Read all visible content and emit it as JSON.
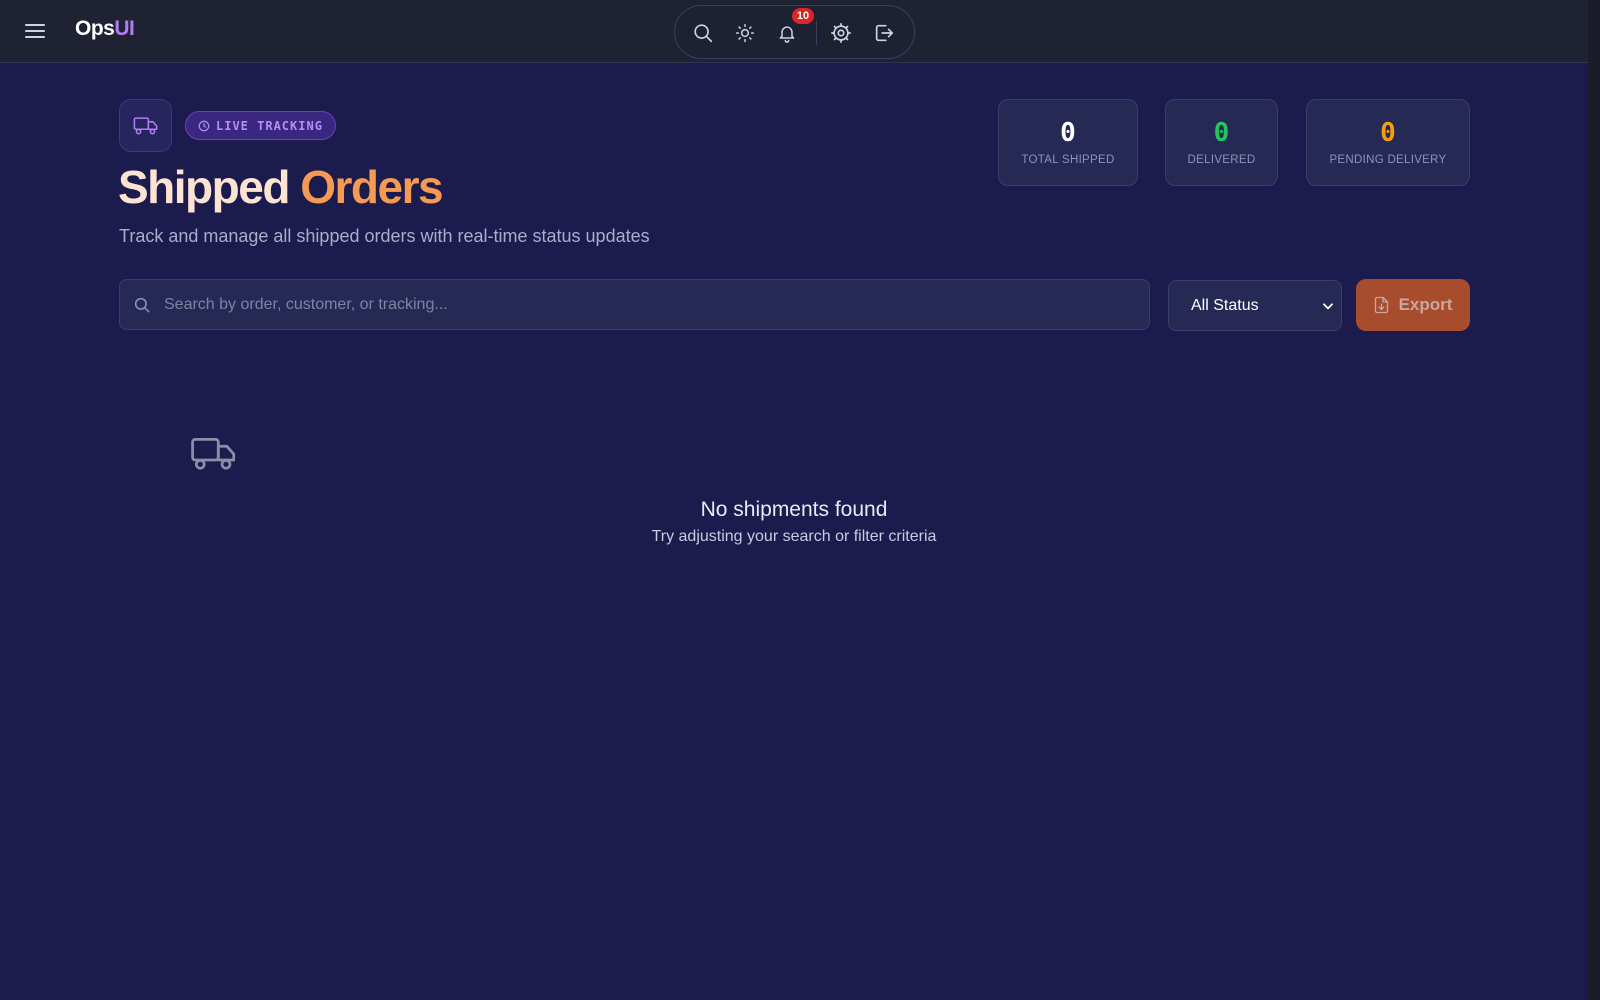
{
  "app": {
    "logo_part1": "Ops",
    "logo_part2": "UI"
  },
  "topbar": {
    "notification_count": "10",
    "icons": [
      "menu-icon",
      "search-icon",
      "sun-icon",
      "bell-icon",
      "gear-icon",
      "logout-icon"
    ]
  },
  "header": {
    "live_label": "LIVE TRACKING",
    "title_part1": "Shipped",
    "title_part2": "Orders",
    "subtitle": "Track and manage all shipped orders with real-time status updates"
  },
  "stats": [
    {
      "value": "0",
      "label": "TOTAL SHIPPED",
      "color": "#ffffff"
    },
    {
      "value": "0",
      "label": "DELIVERED",
      "color": "#22c55e"
    },
    {
      "value": "0",
      "label": "PENDING DELIVERY",
      "color": "#f59e0b"
    }
  ],
  "toolbar": {
    "search_placeholder": "Search by order, customer, or tracking...",
    "status_value": "All Status",
    "export_label": "Export"
  },
  "empty_state": {
    "title": "No shipments found",
    "subtitle": "Try adjusting your search or filter criteria"
  },
  "colors": {
    "background": "#1c1b4d",
    "accent_purple": "#b07cf2",
    "accent_orange": "#f59a53",
    "export_button": "#a74d2e"
  }
}
